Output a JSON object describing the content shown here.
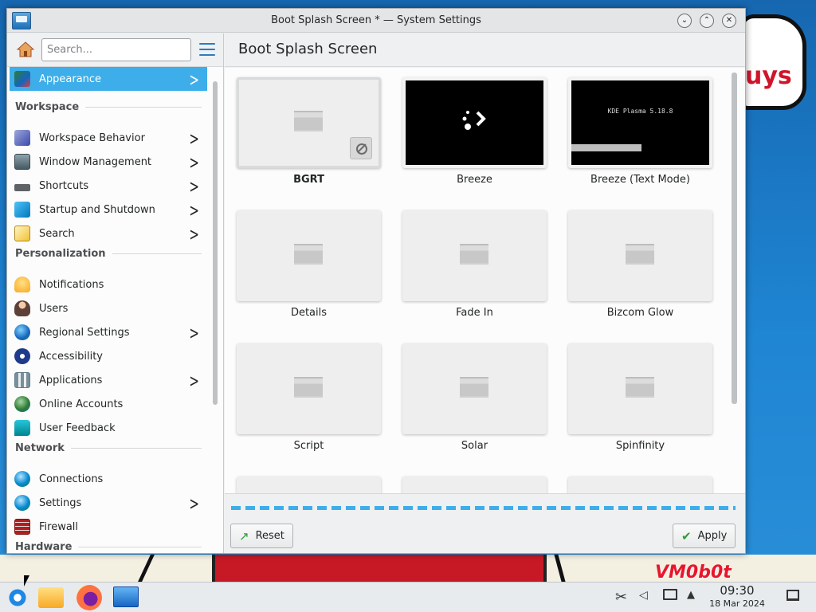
{
  "window": {
    "title": "Boot Splash Screen * — System Settings"
  },
  "sidebar": {
    "search_placeholder": "Search...",
    "selected": {
      "label": "Appearance",
      "icon": "appearance-icon"
    },
    "sections": {
      "workspace": "Workspace",
      "personalization": "Personalization",
      "network": "Network",
      "hardware": "Hardware"
    },
    "workspace_items": [
      {
        "label": "Workspace Behavior",
        "icon": "workspace-behavior-icon"
      },
      {
        "label": "Window Management",
        "icon": "window-management-icon"
      },
      {
        "label": "Shortcuts",
        "icon": "keyboard-icon"
      },
      {
        "label": "Startup and Shutdown",
        "icon": "startup-icon"
      },
      {
        "label": "Search",
        "icon": "search-icon"
      }
    ],
    "personalization_items": [
      {
        "label": "Notifications",
        "icon": "bell-icon"
      },
      {
        "label": "Users",
        "icon": "users-icon"
      },
      {
        "label": "Regional Settings",
        "icon": "globe-icon"
      },
      {
        "label": "Accessibility",
        "icon": "accessibility-icon"
      },
      {
        "label": "Applications",
        "icon": "applications-icon"
      },
      {
        "label": "Online Accounts",
        "icon": "online-accounts-icon"
      },
      {
        "label": "User Feedback",
        "icon": "feedback-icon"
      }
    ],
    "network_items": [
      {
        "label": "Connections",
        "icon": "connections-icon"
      },
      {
        "label": "Settings",
        "icon": "network-settings-icon"
      },
      {
        "label": "Firewall",
        "icon": "firewall-icon"
      }
    ]
  },
  "content": {
    "title": "Boot Splash Screen",
    "themes": [
      {
        "name": "BGRT"
      },
      {
        "name": "Breeze"
      },
      {
        "name": "Breeze (Text Mode)",
        "preview_text": "KDE Plasma 5.18.8"
      },
      {
        "name": "Details"
      },
      {
        "name": "Fade In"
      },
      {
        "name": "Bizcom Glow"
      },
      {
        "name": "Script"
      },
      {
        "name": "Solar"
      },
      {
        "name": "Spinfinity"
      }
    ]
  },
  "buttons": {
    "reset": "Reset",
    "apply": "Apply"
  },
  "taskbar": {
    "time": "09:30",
    "date": "18 Mar 2024"
  },
  "wallpaper": {
    "bubble_text": "uys",
    "watermark": "VM0b0t"
  },
  "colors": {
    "accent": "#3daee9",
    "selection_text": "#ffffff"
  }
}
